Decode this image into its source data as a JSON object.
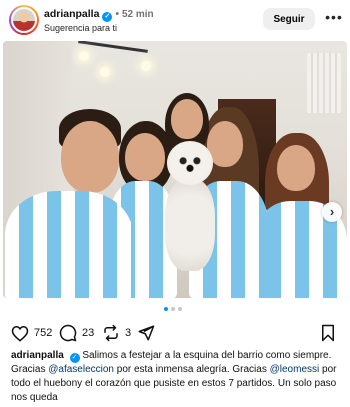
{
  "post": {
    "username": "adrianpalla",
    "verified": true,
    "time": "52 min",
    "subtitle": "Sugerencia para ti",
    "follow_label": "Seguir",
    "more_icon": "more-horizontal-icon"
  },
  "media": {
    "carousel_pages": 3,
    "active_page": 1,
    "next_icon": "chevron-right-icon"
  },
  "actions": {
    "likes": "752",
    "comments": "23",
    "reposts": "3",
    "icons": [
      "heart-icon",
      "comment-icon",
      "repost-icon",
      "share-icon",
      "bookmark-icon"
    ]
  },
  "caption": {
    "username": "adrianpalla",
    "text_1": "Salimos a festejar a la esquina del barrio como siempre. Gracias ",
    "mention_1": "@afaseleccion",
    "text_2": " por esta inmensa alegría. Gracias ",
    "mention_2": "@leomessi",
    "text_3": " por todo el huebony el corazón que pusiste en estos 7 partidos. Un solo paso nos queda"
  },
  "colors": {
    "verified_blue": "#0095f6",
    "mention": "#00376b",
    "jersey_blue": "#7cc3ea"
  }
}
